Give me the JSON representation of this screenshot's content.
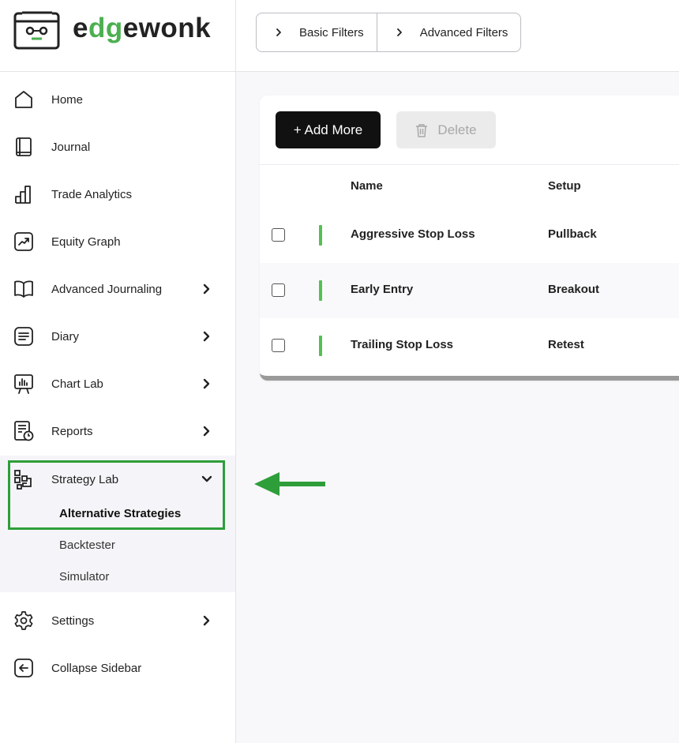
{
  "brand": {
    "logo_prefix": "e",
    "logo_accent": "dg",
    "logo_suffix": "ewonk",
    "accent_color": "#4caf50"
  },
  "topbar": {
    "filters": [
      {
        "label": "Basic Filters",
        "icon": "chevron-right-icon"
      },
      {
        "label": "Advanced Filters",
        "icon": "chevron-right-icon"
      }
    ]
  },
  "sidebar": {
    "items": [
      {
        "label": "Home",
        "icon": "home-icon"
      },
      {
        "label": "Journal",
        "icon": "book-icon"
      },
      {
        "label": "Trade Analytics",
        "icon": "bar-chart-icon"
      },
      {
        "label": "Equity Graph",
        "icon": "trend-chart-icon"
      },
      {
        "label": "Advanced Journaling",
        "icon": "open-book-icon",
        "expandable": true
      },
      {
        "label": "Diary",
        "icon": "note-icon",
        "expandable": true
      },
      {
        "label": "Chart Lab",
        "icon": "presentation-icon",
        "expandable": true
      },
      {
        "label": "Reports",
        "icon": "report-icon",
        "expandable": true
      },
      {
        "label": "Strategy Lab",
        "icon": "strategy-icon",
        "expandable": true,
        "expanded": true
      },
      {
        "label": "Settings",
        "icon": "gear-icon",
        "expandable": true
      },
      {
        "label": "Collapse Sidebar",
        "icon": "collapse-icon"
      }
    ],
    "strategy_lab_subitems": [
      {
        "label": "Alternative Strategies",
        "active": true
      },
      {
        "label": "Backtester"
      },
      {
        "label": "Simulator"
      }
    ],
    "highlight_color": "#2e9e3a"
  },
  "toolbar": {
    "add_label": "+ Add More",
    "delete_label": "Delete"
  },
  "table": {
    "columns": [
      "Name",
      "Setup"
    ],
    "rows": [
      {
        "name": "Aggressive Stop Loss",
        "setup": "Pullback"
      },
      {
        "name": "Early Entry",
        "setup": "Breakout"
      },
      {
        "name": "Trailing Stop Loss",
        "setup": "Retest"
      }
    ],
    "row_marker_color": "#52c152"
  }
}
